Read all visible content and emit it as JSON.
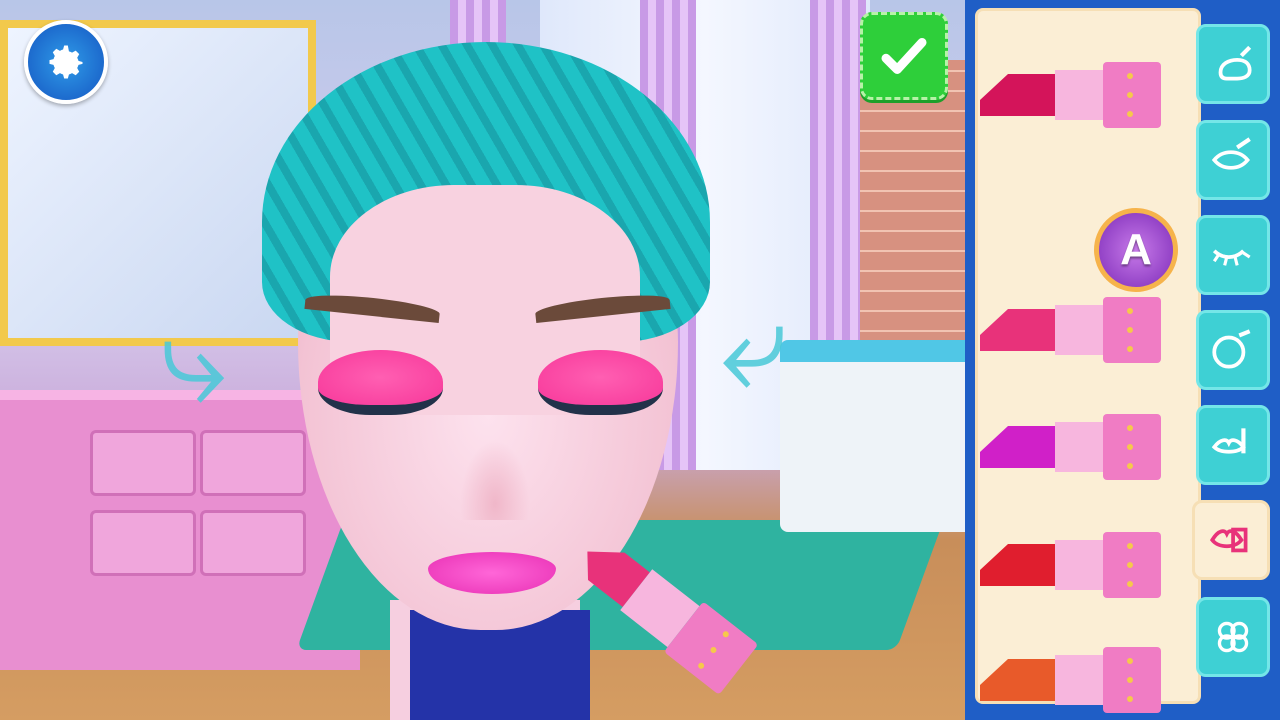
{
  "game": {
    "settings_icon": "gear-icon",
    "confirm_icon": "checkmark-icon",
    "rotate_left_icon": "rotate-left-arrow-icon",
    "rotate_right_icon": "rotate-right-arrow-icon"
  },
  "palette": {
    "badge_letter": "A",
    "lipsticks": [
      {
        "name": "lipstick-1",
        "color": "#d4145a"
      },
      {
        "name": "lipstick-2",
        "color": "#e8327a"
      },
      {
        "name": "lipstick-3",
        "color": "#d020c8"
      },
      {
        "name": "lipstick-4",
        "color": "#e01e2e"
      },
      {
        "name": "lipstick-5",
        "color": "#e85a2a"
      }
    ]
  },
  "categories": [
    {
      "name": "foundation-icon",
      "active": false
    },
    {
      "name": "eyeliner-icon",
      "active": false
    },
    {
      "name": "eyelash-icon",
      "active": false
    },
    {
      "name": "blush-icon",
      "active": false
    },
    {
      "name": "lip-liner-icon",
      "active": false
    },
    {
      "name": "lipstick-icon",
      "active": true
    },
    {
      "name": "clover-sticker-icon",
      "active": false
    }
  ],
  "colors": {
    "panel": "#1f5ec6",
    "tab": "#3ed0d4",
    "tray": "#fbeed5",
    "confirm": "#2ecf3a",
    "lips": "#ff4fd0",
    "eyeshadow": "#ff3fa0",
    "hair": "#1fc2c6"
  }
}
